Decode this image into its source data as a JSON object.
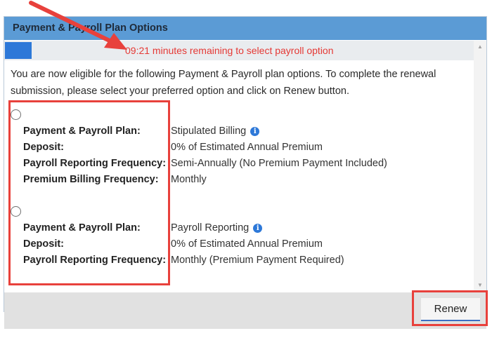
{
  "dialog": {
    "title": "Payment & Payroll Plan Options",
    "timer_text": "09:21 minutes remaining to select payroll option",
    "timer_progress_fraction": 0.06,
    "intro_text": "You are now eligible for the following Payment & Payroll plan options. To complete the renewal submission, please select your preferred option and click on Renew button.",
    "options": [
      {
        "selected": false,
        "rows": [
          {
            "label": "Payment & Payroll Plan:",
            "value": "Stipulated Billing",
            "info_icon": true
          },
          {
            "label": "Deposit:",
            "value": "0% of Estimated Annual Premium"
          },
          {
            "label": "Payroll Reporting Frequency:",
            "value": "Semi-Annually (No Premium Payment Included)"
          },
          {
            "label": "Premium Billing Frequency:",
            "value": "Monthly"
          }
        ]
      },
      {
        "selected": false,
        "rows": [
          {
            "label": "Payment & Payroll Plan:",
            "value": "Payroll Reporting",
            "info_icon": true
          },
          {
            "label": "Deposit:",
            "value": "0% of Estimated Annual Premium"
          },
          {
            "label": "Payroll Reporting Frequency:",
            "value": "Monthly (Premium Payment Required)"
          }
        ]
      }
    ],
    "renew_label": "Renew",
    "info_icon_glyph": "i"
  },
  "colors": {
    "title_bar": "#5b9bd5",
    "progress": "#2d78d8",
    "timer_text": "#e53935",
    "annotation": "#e8413c"
  }
}
